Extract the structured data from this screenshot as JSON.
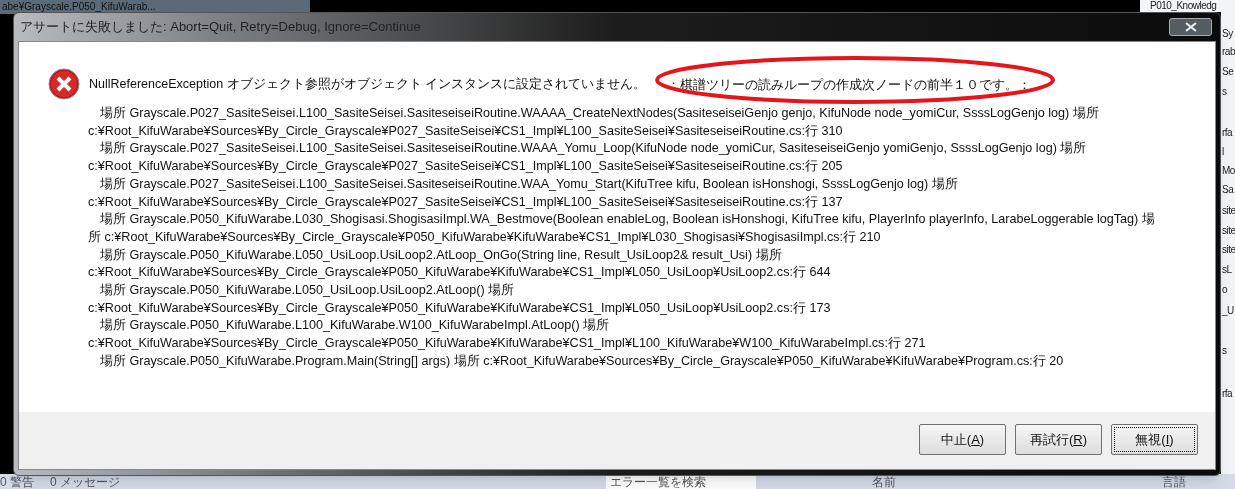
{
  "background": {
    "window_title": "abe¥Grayscale.P050_KifuWarab...",
    "side_items": [
      "P010_Knowledg",
      "Sy",
      "rab",
      "Se",
      "s",
      "rfa",
      "l",
      "Mo",
      "Sa",
      "site",
      "site",
      "site",
      "sL",
      "o",
      "_U",
      "s",
      "rfa"
    ],
    "status_items": [
      "0 警告",
      "0 メッセージ"
    ],
    "search_placeholder": "エラー一覧を検索",
    "columns": [
      "名前",
      "言語"
    ]
  },
  "dialog": {
    "title": "アサートに失敗しました: Abort=Quit, Retry=Debug, Ignore=Continue",
    "message": {
      "exception": "NullReferenceException オブジェクト参照がオブジェクト インスタンスに設定されていません。",
      "detail": "：棋譜ツリーの読みループの作成次ノードの前半１０です。："
    },
    "annotation": {
      "kind": "ellipse",
      "color": "#e8141c"
    },
    "stack_lines": [
      {
        "kind": "frame",
        "text": "場所 Grayscale.P027_SasiteSeisei.L100_SasiteSeisei.SasiteseiseiRoutine.WAAAA_CreateNextNodes(SasiteseiseiGenjo genjo, KifuNode node_yomiCur, SsssLogGenjo log) 場所"
      },
      {
        "kind": "path",
        "text": "c:¥Root_KifuWarabe¥Sources¥By_Circle_Grayscale¥P027_SasiteSeisei¥CS1_Impl¥L100_SasiteSeisei¥SasiteseiseiRoutine.cs:行 310"
      },
      {
        "kind": "frame",
        "text": "場所 Grayscale.P027_SasiteSeisei.L100_SasiteSeisei.SasiteseiseiRoutine.WAAA_Yomu_Loop(KifuNode node_yomiCur, SasiteseiseiGenjo yomiGenjo, SsssLogGenjo log) 場所"
      },
      {
        "kind": "path",
        "text": "c:¥Root_KifuWarabe¥Sources¥By_Circle_Grayscale¥P027_SasiteSeisei¥CS1_Impl¥L100_SasiteSeisei¥SasiteseiseiRoutine.cs:行 205"
      },
      {
        "kind": "frame",
        "text": "場所 Grayscale.P027_SasiteSeisei.L100_SasiteSeisei.SasiteseiseiRoutine.WAA_Yomu_Start(KifuTree kifu, Boolean isHonshogi, SsssLogGenjo log) 場所"
      },
      {
        "kind": "path",
        "text": "c:¥Root_KifuWarabe¥Sources¥By_Circle_Grayscale¥P027_SasiteSeisei¥CS1_Impl¥L100_SasiteSeisei¥SasiteseiseiRoutine.cs:行 137"
      },
      {
        "kind": "frame",
        "text": "場所 Grayscale.P050_KifuWarabe.L030_Shogisasi.ShogisasiImpl.WA_Bestmove(Boolean enableLog, Boolean isHonshogi, KifuTree kifu, PlayerInfo playerInfo, LarabeLoggerable logTag) 場"
      },
      {
        "kind": "path",
        "text": "所 c:¥Root_KifuWarabe¥Sources¥By_Circle_Grayscale¥P050_KifuWarabe¥KifuWarabe¥CS1_Impl¥L030_Shogisasi¥ShogisasiImpl.cs:行 210"
      },
      {
        "kind": "frame",
        "text": "場所 Grayscale.P050_KifuWarabe.L050_UsiLoop.UsiLoop2.AtLoop_OnGo(String line, Result_UsiLoop2& result_Usi) 場所"
      },
      {
        "kind": "path",
        "text": "c:¥Root_KifuWarabe¥Sources¥By_Circle_Grayscale¥P050_KifuWarabe¥KifuWarabe¥CS1_Impl¥L050_UsiLoop¥UsiLoop2.cs:行 644"
      },
      {
        "kind": "frame",
        "text": "場所 Grayscale.P050_KifuWarabe.L050_UsiLoop.UsiLoop2.AtLoop() 場所"
      },
      {
        "kind": "path",
        "text": "c:¥Root_KifuWarabe¥Sources¥By_Circle_Grayscale¥P050_KifuWarabe¥KifuWarabe¥CS1_Impl¥L050_UsiLoop¥UsiLoop2.cs:行 173"
      },
      {
        "kind": "frame",
        "text": "場所 Grayscale.P050_KifuWarabe.L100_KifuWarabe.W100_KifuWarabeImpl.AtLoop() 場所"
      },
      {
        "kind": "path",
        "text": "c:¥Root_KifuWarabe¥Sources¥By_Circle_Grayscale¥P050_KifuWarabe¥KifuWarabe¥CS1_Impl¥L100_KifuWarabe¥W100_KifuWarabeImpl.cs:行 271"
      },
      {
        "kind": "frame",
        "text": "場所 Grayscale.P050_KifuWarabe.Program.Main(String[] args) 場所 c:¥Root_KifuWarabe¥Sources¥By_Circle_Grayscale¥P050_KifuWarabe¥KifuWarabe¥Program.cs:行 20"
      }
    ],
    "buttons": [
      {
        "before": "中止(",
        "key": "A",
        "after": ")",
        "focused": false
      },
      {
        "before": "再試行(",
        "key": "R",
        "after": ")",
        "focused": false
      },
      {
        "before": "無視(",
        "key": "I",
        "after": ")",
        "focused": true
      }
    ]
  }
}
